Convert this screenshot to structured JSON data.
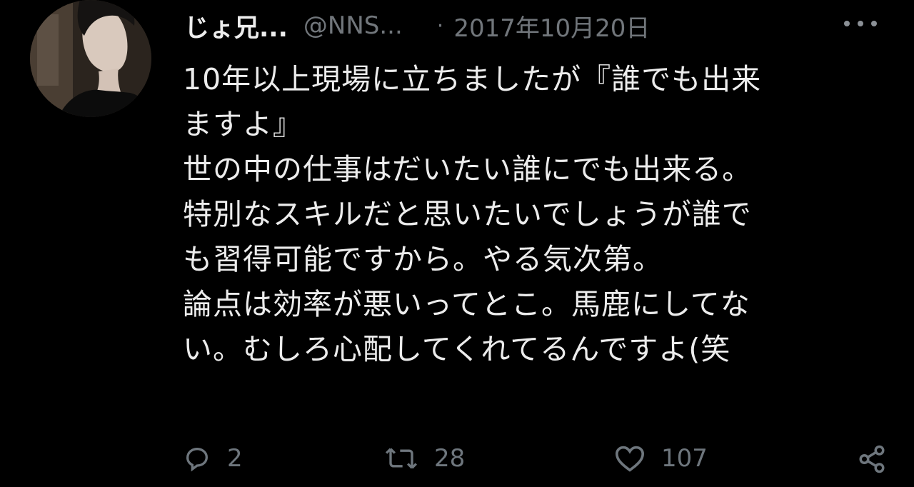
{
  "tweet": {
    "display_name": "じょ兄...",
    "handle": "@NNS...",
    "separator": "·",
    "date": "2017年10月20日",
    "lines": [
      "10年以上現場に立ちましたが『誰でも出来",
      "ますよ』",
      "世の中の仕事はだいたい誰にでも出来る。",
      "特別なスキルだと思いたいでしょうが誰で",
      "も習得可能ですから。やる気次第。",
      "論点は効率が悪いってとこ。馬鹿にしてな",
      "い。むしろ心配してくれてるんですよ(笑"
    ],
    "actions": {
      "reply_count": "2",
      "retweet_count": "28",
      "like_count": "107"
    }
  },
  "icons": {
    "more": "more-horizontal-icon",
    "reply": "reply-icon",
    "retweet": "retweet-icon",
    "like": "heart-icon",
    "share": "share-icon"
  },
  "colors": {
    "background": "#000000",
    "text_primary": "#ececec",
    "text_secondary": "#71767b"
  }
}
